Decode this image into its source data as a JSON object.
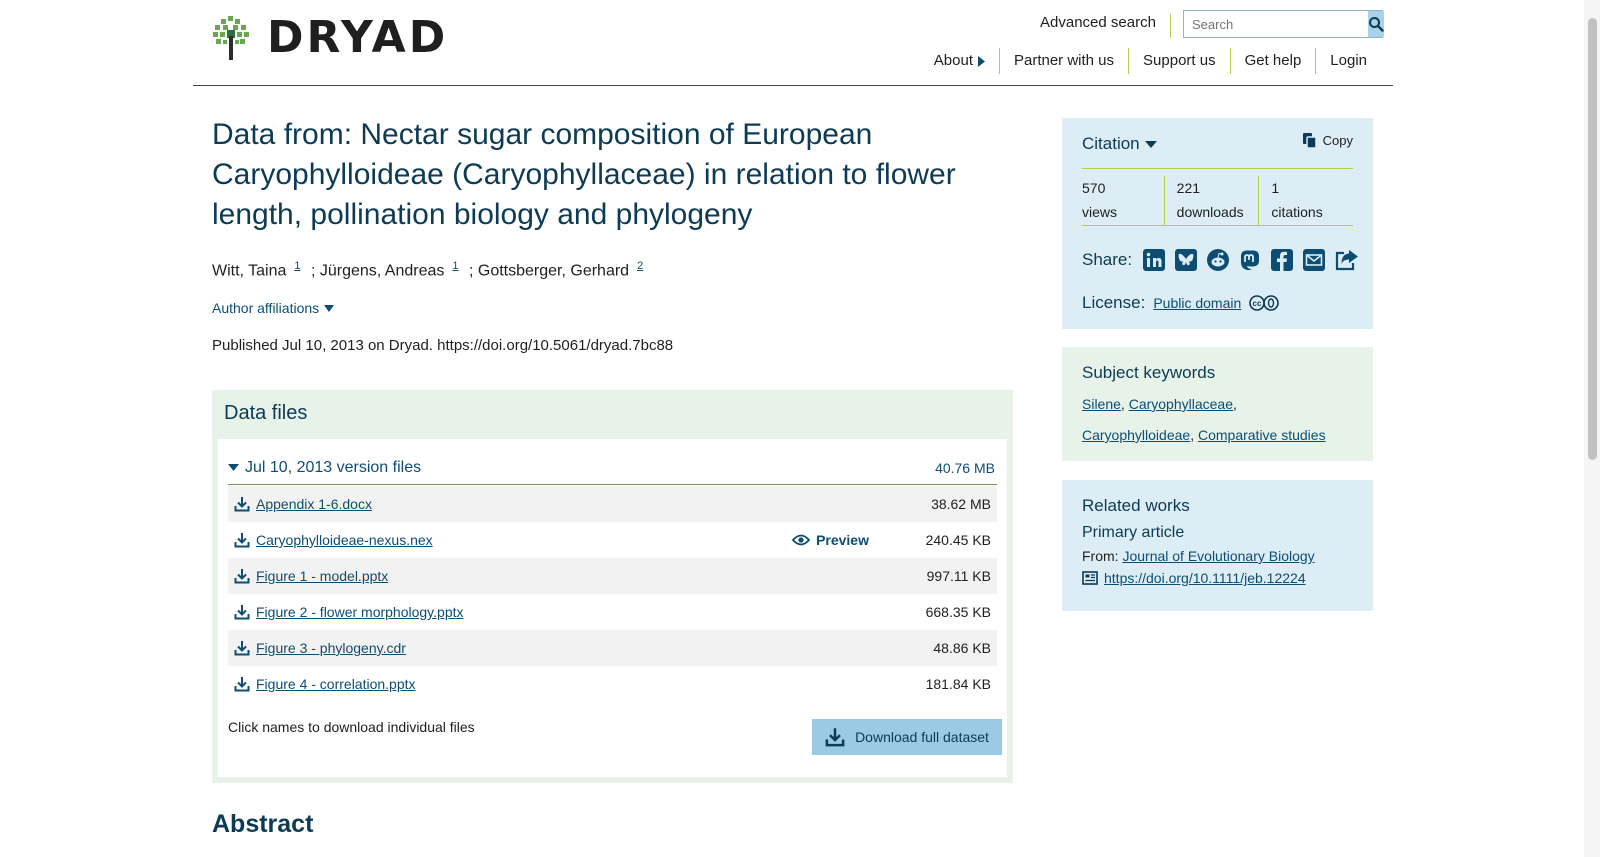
{
  "header": {
    "logo_text": "DRYAD",
    "advanced_search": "Advanced search",
    "search_placeholder": "Search",
    "nav": [
      {
        "label": "About"
      },
      {
        "label": "Partner with us"
      },
      {
        "label": "Support us"
      },
      {
        "label": "Get help"
      },
      {
        "label": "Login"
      }
    ]
  },
  "dataset": {
    "title": "Data from: Nectar sugar composition of European Caryophylloideae (Caryophyllaceae) in relation to flower length, pollination biology and phylogeny",
    "authors": [
      {
        "name": "Witt, Taina",
        "affil": "1"
      },
      {
        "name": "; Jürgens, Andreas",
        "affil": "1"
      },
      {
        "name": "; Gottsberger, Gerhard",
        "affil": "2"
      }
    ],
    "author_affiliations": "Author affiliations",
    "published": "Published Jul 10, 2013 on Dryad. https://doi.org/10.5061/dryad.7bc88"
  },
  "files": {
    "panel_title": "Data files",
    "version_label": "Jul 10, 2013 version files",
    "version_size": "40.76 MB",
    "preview_label": "Preview",
    "list": [
      {
        "name": "Appendix 1-6.docx",
        "size": "38.62 MB"
      },
      {
        "name": "Caryophylloideae-nexus.nex",
        "size": "240.45 KB"
      },
      {
        "name": "Figure 1 - model.pptx",
        "size": "997.11 KB"
      },
      {
        "name": "Figure 2 - flower morphology.pptx",
        "size": "668.35 KB"
      },
      {
        "name": "Figure 3 - phylogeny.cdr",
        "size": "48.86 KB"
      },
      {
        "name": "Figure 4 - correlation.pptx",
        "size": "181.84 KB"
      }
    ],
    "click_note": "Click names to download individual files",
    "download_full": "Download full dataset"
  },
  "abstract_heading": "Abstract",
  "sidebar": {
    "citation_label": "Citation",
    "copy_label": "Copy",
    "metrics": [
      {
        "value": "570",
        "label": "views"
      },
      {
        "value": "221",
        "label": "downloads"
      },
      {
        "value": "1",
        "label": "citations"
      }
    ],
    "share_label": "Share:",
    "license_label": "License:",
    "license_value": "Public domain",
    "keywords_title": "Subject keywords",
    "keywords": [
      "Silene",
      "Caryophyllaceae",
      "Caryophylloideae",
      "Comparative studies"
    ],
    "related_title": "Related works",
    "related_sub": "Primary article",
    "related_from_label": "From:",
    "related_journal": "Journal of Evolutionary Biology",
    "related_doi": "https://doi.org/10.1111/jeb.12224"
  },
  "colors": {
    "brand_dark": "#0d3a54",
    "link": "#0d4d73",
    "accent_green": "#b6cf4a",
    "panel_blue": "#dcedf5",
    "panel_green": "#e7f2e8"
  }
}
